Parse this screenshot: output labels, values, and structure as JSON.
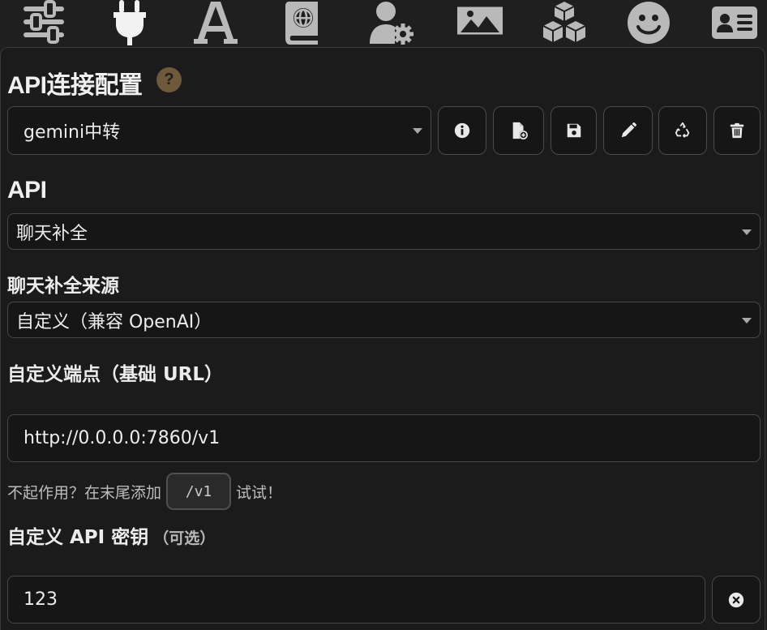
{
  "topbar": {
    "icons": [
      {
        "name": "sliders-icon"
      },
      {
        "name": "plug-icon"
      },
      {
        "name": "font-a-icon"
      },
      {
        "name": "book-globe-icon"
      },
      {
        "name": "user-gear-icon"
      },
      {
        "name": "image-icon"
      },
      {
        "name": "cubes-icon"
      },
      {
        "name": "smiley-icon"
      },
      {
        "name": "id-card-icon"
      }
    ],
    "active_color": "#f2f2f2",
    "inactive_color": "#b9b9b9"
  },
  "api_config": {
    "title": "API连接配置",
    "help_label": "?",
    "profile_select_value": "gemini中转",
    "buttons": [
      {
        "name": "info-button",
        "icon": "info-circle-icon"
      },
      {
        "name": "new-profile-button",
        "icon": "file-plus-icon"
      },
      {
        "name": "save-button",
        "icon": "floppy-disk-icon"
      },
      {
        "name": "rename-button",
        "icon": "pencil-icon"
      },
      {
        "name": "recycle-button",
        "icon": "recycle-icon"
      },
      {
        "name": "delete-button",
        "icon": "trash-icon"
      }
    ]
  },
  "api": {
    "label": "API",
    "select_value": "聊天补全"
  },
  "chat_source": {
    "label": "聊天补全来源",
    "select_value": "自定义（兼容 OpenAI）"
  },
  "endpoint": {
    "label": "自定义端点（基础 URL）",
    "value": "http://0.0.0.0:7860/v1",
    "hint_before": "不起作用？在末尾添加",
    "hint_code": "/v1",
    "hint_after": "试试！"
  },
  "api_key": {
    "label": "自定义 API 密钥",
    "optional_label": "（可选）",
    "value": "123",
    "clear_icon": "clear-x-circle-icon"
  },
  "colors": {
    "help_badge": "#6e5a3a",
    "background": "#1f1f20",
    "panel": "#1b1b1c"
  }
}
